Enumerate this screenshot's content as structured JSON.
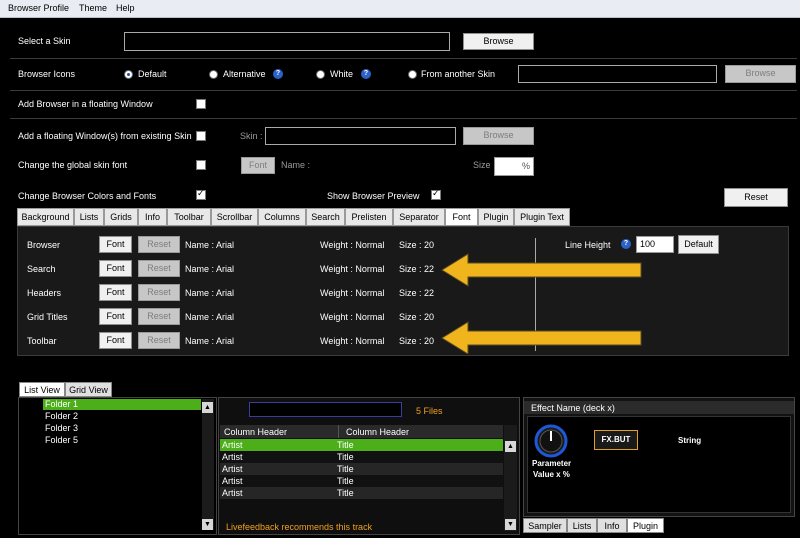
{
  "menubar": {
    "items": [
      "Browser Profile",
      "Theme",
      "Help"
    ]
  },
  "settings": {
    "select_skin": {
      "label": "Select a Skin",
      "browse": "Browse"
    },
    "browser_icons": {
      "label": "Browser Icons",
      "options": [
        "Default",
        "Alternative",
        "White",
        "From another Skin"
      ],
      "selected": "Default",
      "browse": "Browse"
    },
    "floating_window": {
      "label": "Add Browser in a floating Window"
    },
    "floating_existing": {
      "label": "Add a floating Window(s) from existing Skin",
      "skin_label": "Skin :",
      "browse": "Browse"
    },
    "global_font": {
      "label": "Change the global skin font",
      "font_button": "Font",
      "name_label": "Name :",
      "size_label": "Size",
      "size_unit": "%"
    },
    "colors_fonts": {
      "label": "Change Browser Colors and Fonts",
      "checked": true
    },
    "preview": {
      "label": "Show Browser Preview",
      "checked": true
    },
    "reset": "Reset"
  },
  "tabs": [
    "Background",
    "Lists",
    "Grids",
    "Info",
    "Toolbar",
    "Scrollbar",
    "Columns",
    "Search",
    "Prelisten",
    "Separator",
    "Font",
    "Plugin",
    "Plugin Text"
  ],
  "active_tab": "Font",
  "font_panel": {
    "font_button": "Font",
    "reset_button": "Reset",
    "rows": [
      {
        "label": "Browser",
        "name": "Name : Arial",
        "weight": "Weight : Normal",
        "size": "Size : 20"
      },
      {
        "label": "Search",
        "name": "Name : Arial",
        "weight": "Weight : Normal",
        "size": "Size : 22"
      },
      {
        "label": "Headers",
        "name": "Name : Arial",
        "weight": "Weight : Normal",
        "size": "Size : 22"
      },
      {
        "label": "Grid Titles",
        "name": "Name : Arial",
        "weight": "Weight : Normal",
        "size": "Size : 20"
      },
      {
        "label": "Toolbar",
        "name": "Name : Arial",
        "weight": "Weight : Normal",
        "size": "Size : 20"
      }
    ],
    "line_height": {
      "label": "Line Height",
      "value": "100",
      "default_button": "Default"
    },
    "arrow_color": "#f0b41c"
  },
  "preview": {
    "view_tabs": [
      "List View",
      "Grid View"
    ],
    "active_view": "List View",
    "folders": [
      "Folder 1",
      "Folder 2",
      "Folder 3",
      "Folder 5"
    ],
    "selected_folder": "Folder 1",
    "files_count": "5 Files",
    "columns": [
      "Column Header",
      "Column Header"
    ],
    "rows": [
      {
        "artist": "Artist",
        "title": "Title"
      },
      {
        "artist": "Artist",
        "title": "Title"
      },
      {
        "artist": "Artist",
        "title": "Title"
      },
      {
        "artist": "Artist",
        "title": "Title"
      },
      {
        "artist": "Artist",
        "title": "Title"
      }
    ],
    "recommend": "Livefeedback recommends this track",
    "effect": {
      "title": "Effect Name (deck x)",
      "parameter": "Parameter",
      "value": "Value x %",
      "button": "FX.BUT",
      "string": "String"
    },
    "bottom_tabs": [
      "Sampler",
      "Lists",
      "Info",
      "Plugin"
    ],
    "active_bottom": "Plugin",
    "accent": "#4caf1a",
    "orange": "#f0a020"
  }
}
